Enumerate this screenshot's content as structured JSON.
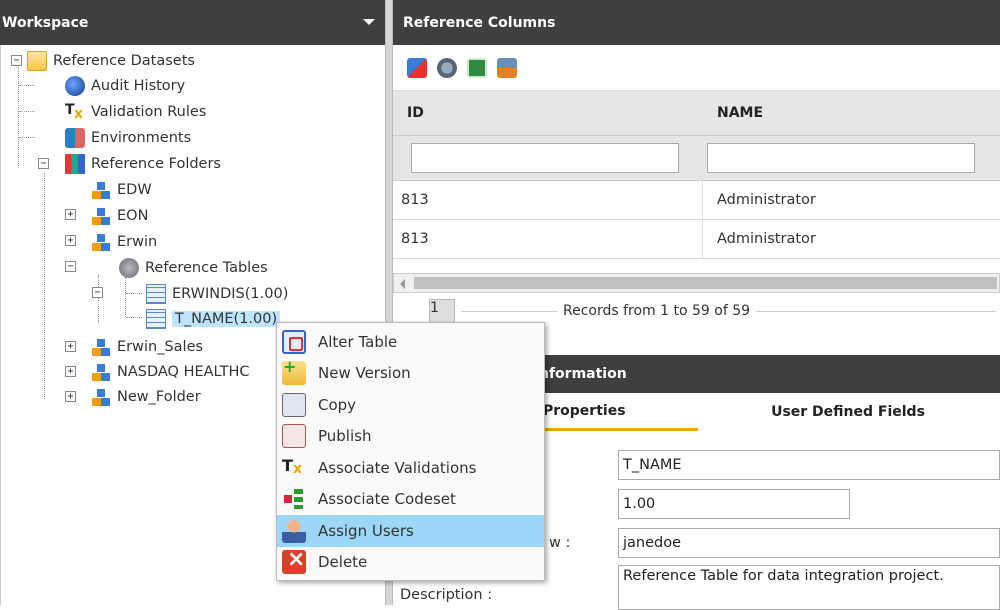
{
  "workspace": {
    "title": "Workspace",
    "tree": {
      "root": "Reference Datasets",
      "audit_history": "Audit History",
      "validation_rules": "Validation Rules",
      "environments": "Environments",
      "reference_folders": "Reference Folders",
      "folders": {
        "edw": "EDW",
        "eon": "EON",
        "erwin": "Erwin",
        "erwin_sales": "Erwin_Sales",
        "nasdaq": "NASDAQ HEALTHC",
        "new_folder": "New_Folder"
      },
      "reference_tables": "Reference Tables",
      "tables": [
        "ERWINDIS(1.00)",
        "T_NAME(1.00)"
      ]
    }
  },
  "reference_columns": {
    "title": "Reference Columns",
    "columns": [
      "ID",
      "NAME"
    ],
    "rows": [
      {
        "id": "813",
        "name": "Administrator"
      },
      {
        "id": "813",
        "name": "Administrator"
      }
    ],
    "pager": {
      "page": "1",
      "records_text": "Records from 1 to 59 of 59"
    }
  },
  "information": {
    "title": "nformation",
    "tabs": [
      "Properties",
      "User Defined Fields"
    ],
    "fields": {
      "name": "T_NAME",
      "version": "1.00",
      "owner_label": "w :",
      "owner": "janedoe",
      "description_label": "Description :",
      "description": "Reference Table for data integration project."
    }
  },
  "context_menu": {
    "items": [
      {
        "label": "Alter Table",
        "icon": "alter-table-icon"
      },
      {
        "label": "New Version",
        "icon": "new-version-icon"
      },
      {
        "label": "Copy",
        "icon": "copy-icon"
      },
      {
        "label": "Publish",
        "icon": "publish-icon"
      },
      {
        "label": "Associate Validations",
        "icon": "validations-icon"
      },
      {
        "label": "Associate Codeset",
        "icon": "codeset-icon"
      },
      {
        "label": "Assign Users",
        "icon": "users-icon"
      },
      {
        "label": "Delete",
        "icon": "delete-icon"
      }
    ]
  },
  "colors": {
    "header": "#3f3f3f",
    "selection": "#bfe4ff",
    "menu_highlight": "#9cd7f7",
    "tab_accent": "#f0a500"
  }
}
